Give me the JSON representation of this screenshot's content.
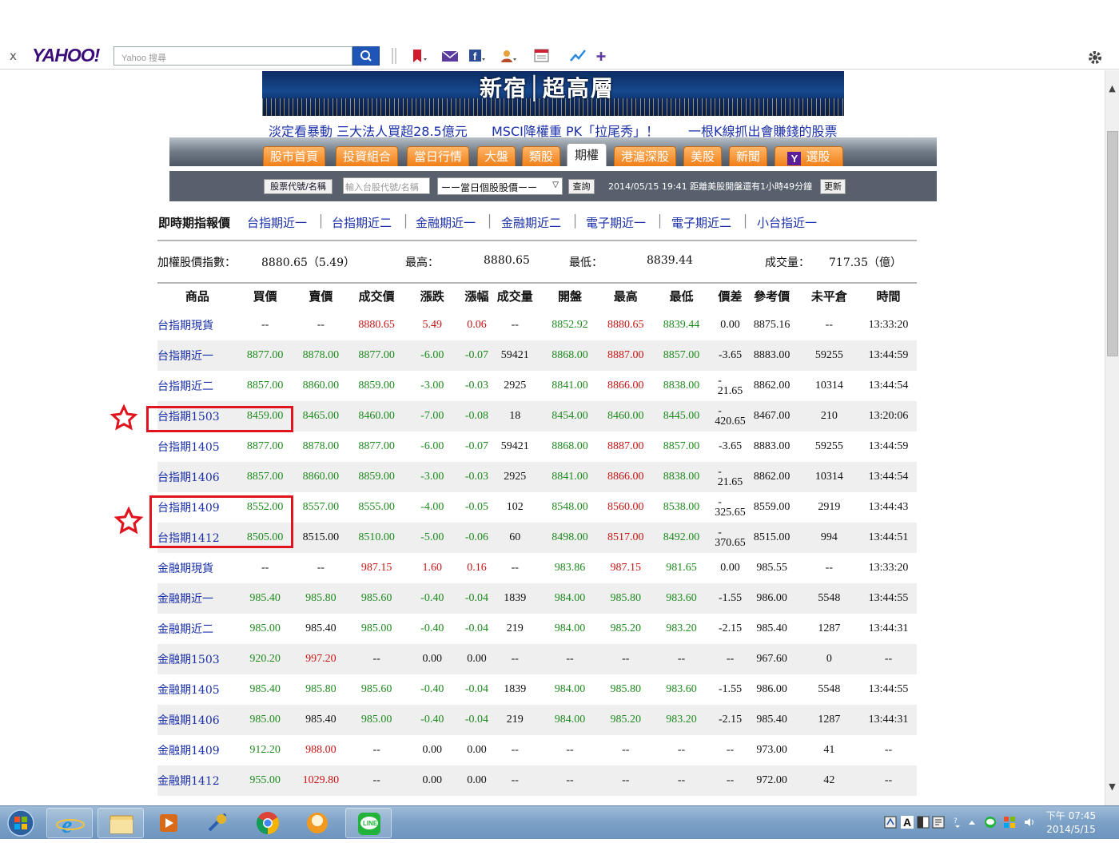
{
  "toolbar": {
    "close_label": "x",
    "logo": "YAHOO!",
    "search_placeholder": "Yahoo 搜尋"
  },
  "banner": {
    "text": "新宿│超高層"
  },
  "headlines": [
    "淡定看暴動 三大法人買超28.5億元",
    "MSCI降權重 PK「拉尾秀」！",
    "一根K線抓出會賺錢的股票"
  ],
  "nav": {
    "tabs": [
      "股市首頁",
      "投資組合",
      "當日行情",
      "大盤",
      "類股",
      "期權",
      "港滬深股",
      "美股",
      "新聞",
      "選股"
    ],
    "active": "期權",
    "yahoo_badge": "Y"
  },
  "search": {
    "type_button": "股票代號/名稱",
    "input_placeholder": "輸入台股代號/名稱",
    "select_value": "ーー當日個股股價ーー",
    "query_button": "查詢",
    "time_text": "2014/05/15 19:41 距離美股開盤還有1小時49分鐘",
    "update_button": "更新"
  },
  "subnav": {
    "title": "即時期指報價",
    "links": [
      "台指期近一",
      "台指期近二",
      "金融期近一",
      "金融期近二",
      "電子期近一",
      "電子期近二",
      "小台指近一"
    ],
    "separator": "│"
  },
  "index": {
    "label": "加權股價指數：",
    "value": "8880.65（5.49）",
    "high_label": "最高：",
    "high": "8880.65",
    "low_label": "最低：",
    "low": "8839.44",
    "volume_label": "成交量：",
    "volume": "717.35（億）"
  },
  "table": {
    "headers": [
      "商品",
      "買價",
      "賣價",
      "成交價",
      "漲跌",
      "漲幅",
      "成交量",
      "開盤",
      "最高",
      "最低",
      "價差",
      "參考價",
      "未平倉",
      "時間"
    ],
    "rows": [
      [
        "台指期現貨",
        "--",
        "--",
        "8880.65",
        "5.49",
        "0.06",
        "--",
        "8852.92",
        "8880.65",
        "8839.44",
        "0.00",
        "8875.16",
        "--",
        "13:33:20"
      ],
      [
        "台指期近一",
        "8877.00",
        "8878.00",
        "8877.00",
        "-6.00",
        "-0.07",
        "59421",
        "8868.00",
        "8887.00",
        "8857.00",
        "-3.65",
        "8883.00",
        "59255",
        "13:44:59"
      ],
      [
        "台指期近二",
        "8857.00",
        "8860.00",
        "8859.00",
        "-3.00",
        "-0.03",
        "2925",
        "8841.00",
        "8866.00",
        "8838.00",
        "-21.65",
        "8862.00",
        "10314",
        "13:44:54"
      ],
      [
        "台指期1503",
        "8459.00",
        "8465.00",
        "8460.00",
        "-7.00",
        "-0.08",
        "18",
        "8454.00",
        "8460.00",
        "8445.00",
        "-420.65",
        "8467.00",
        "210",
        "13:20:06"
      ],
      [
        "台指期1405",
        "8877.00",
        "8878.00",
        "8877.00",
        "-6.00",
        "-0.07",
        "59421",
        "8868.00",
        "8887.00",
        "8857.00",
        "-3.65",
        "8883.00",
        "59255",
        "13:44:59"
      ],
      [
        "台指期1406",
        "8857.00",
        "8860.00",
        "8859.00",
        "-3.00",
        "-0.03",
        "2925",
        "8841.00",
        "8866.00",
        "8838.00",
        "-21.65",
        "8862.00",
        "10314",
        "13:44:54"
      ],
      [
        "台指期1409",
        "8552.00",
        "8557.00",
        "8555.00",
        "-4.00",
        "-0.05",
        "102",
        "8548.00",
        "8560.00",
        "8538.00",
        "-325.65",
        "8559.00",
        "2919",
        "13:44:43"
      ],
      [
        "台指期1412",
        "8505.00",
        "8515.00",
        "8510.00",
        "-5.00",
        "-0.06",
        "60",
        "8498.00",
        "8517.00",
        "8492.00",
        "-370.65",
        "8515.00",
        "994",
        "13:44:51"
      ],
      [
        "金融期現貨",
        "--",
        "--",
        "987.15",
        "1.60",
        "0.16",
        "--",
        "983.86",
        "987.15",
        "981.65",
        "0.00",
        "985.55",
        "--",
        "13:33:20"
      ],
      [
        "金融期近一",
        "985.40",
        "985.80",
        "985.60",
        "-0.40",
        "-0.04",
        "1839",
        "984.00",
        "985.80",
        "983.60",
        "-1.55",
        "986.00",
        "5548",
        "13:44:55"
      ],
      [
        "金融期近二",
        "985.00",
        "985.40",
        "985.00",
        "-0.40",
        "-0.04",
        "219",
        "984.00",
        "985.20",
        "983.20",
        "-2.15",
        "985.40",
        "1287",
        "13:44:31"
      ],
      [
        "金融期1503",
        "920.20",
        "997.20",
        "--",
        "0.00",
        "0.00",
        "--",
        "--",
        "--",
        "--",
        "--",
        "967.60",
        "0",
        "--"
      ],
      [
        "金融期1405",
        "985.40",
        "985.80",
        "985.60",
        "-0.40",
        "-0.04",
        "1839",
        "984.00",
        "985.80",
        "983.60",
        "-1.55",
        "986.00",
        "5548",
        "13:44:55"
      ],
      [
        "金融期1406",
        "985.00",
        "985.40",
        "985.00",
        "-0.40",
        "-0.04",
        "219",
        "984.00",
        "985.20",
        "983.20",
        "-2.15",
        "985.40",
        "1287",
        "13:44:31"
      ],
      [
        "金融期1409",
        "912.20",
        "988.00",
        "--",
        "0.00",
        "0.00",
        "--",
        "--",
        "--",
        "--",
        "--",
        "973.00",
        "41",
        "--"
      ],
      [
        "金融期1412",
        "955.00",
        "1029.80",
        "--",
        "0.00",
        "0.00",
        "--",
        "--",
        "--",
        "--",
        "--",
        "972.00",
        "42",
        "--"
      ]
    ],
    "cell_colors": [
      [
        "blue",
        "black",
        "black",
        "red",
        "red",
        "red",
        "black",
        "green",
        "red",
        "green",
        "black",
        "black",
        "black",
        "black"
      ],
      [
        "blue",
        "green",
        "green",
        "green",
        "green",
        "green",
        "black",
        "green",
        "red",
        "green",
        "black",
        "black",
        "black",
        "black"
      ],
      [
        "blue",
        "green",
        "green",
        "green",
        "green",
        "green",
        "black",
        "green",
        "red",
        "green",
        "black",
        "black",
        "black",
        "black"
      ],
      [
        "blue",
        "green",
        "green",
        "green",
        "green",
        "green",
        "black",
        "green",
        "green",
        "green",
        "black",
        "black",
        "black",
        "black"
      ],
      [
        "blue",
        "green",
        "green",
        "green",
        "green",
        "green",
        "black",
        "green",
        "red",
        "green",
        "black",
        "black",
        "black",
        "black"
      ],
      [
        "blue",
        "green",
        "green",
        "green",
        "green",
        "green",
        "black",
        "green",
        "red",
        "green",
        "black",
        "black",
        "black",
        "black"
      ],
      [
        "blue",
        "green",
        "green",
        "green",
        "green",
        "green",
        "black",
        "green",
        "red",
        "green",
        "black",
        "black",
        "black",
        "black"
      ],
      [
        "blue",
        "green",
        "black",
        "green",
        "green",
        "green",
        "black",
        "green",
        "red",
        "green",
        "black",
        "black",
        "black",
        "black"
      ],
      [
        "blue",
        "black",
        "black",
        "red",
        "red",
        "red",
        "black",
        "green",
        "red",
        "green",
        "black",
        "black",
        "black",
        "black"
      ],
      [
        "blue",
        "green",
        "green",
        "green",
        "green",
        "green",
        "black",
        "green",
        "green",
        "green",
        "black",
        "black",
        "black",
        "black"
      ],
      [
        "blue",
        "green",
        "black",
        "green",
        "green",
        "green",
        "black",
        "green",
        "green",
        "green",
        "black",
        "black",
        "black",
        "black"
      ],
      [
        "blue",
        "green",
        "red",
        "black",
        "black",
        "black",
        "black",
        "black",
        "black",
        "black",
        "black",
        "black",
        "black",
        "black"
      ],
      [
        "blue",
        "green",
        "green",
        "green",
        "green",
        "green",
        "black",
        "green",
        "green",
        "green",
        "black",
        "black",
        "black",
        "black"
      ],
      [
        "blue",
        "green",
        "black",
        "green",
        "green",
        "green",
        "black",
        "green",
        "green",
        "green",
        "black",
        "black",
        "black",
        "black"
      ],
      [
        "blue",
        "green",
        "red",
        "black",
        "black",
        "black",
        "black",
        "black",
        "black",
        "black",
        "black",
        "black",
        "black",
        "black"
      ],
      [
        "blue",
        "green",
        "red",
        "black",
        "black",
        "black",
        "black",
        "black",
        "black",
        "black",
        "black",
        "black",
        "black",
        "black"
      ]
    ]
  },
  "annotations": {
    "color": "#e0141e",
    "highlighted_rows": [
      "台指期1503",
      "台指期1409",
      "台指期1412"
    ]
  },
  "taskbar": {
    "apps": [
      "start-orb",
      "internet-explorer",
      "file-explorer",
      "media-player",
      "satellite-tool",
      "chrome",
      "fox-app",
      "line"
    ],
    "clock_time": "下午 07:45",
    "clock_date": "2014/5/15",
    "tray_text": "A"
  },
  "colors": {
    "accent_orange": "#f07f17",
    "nav_gray": "#57606c",
    "link_blue": "#1a2fa8",
    "up_red": "#c81414",
    "down_green": "#1d8a1d"
  }
}
